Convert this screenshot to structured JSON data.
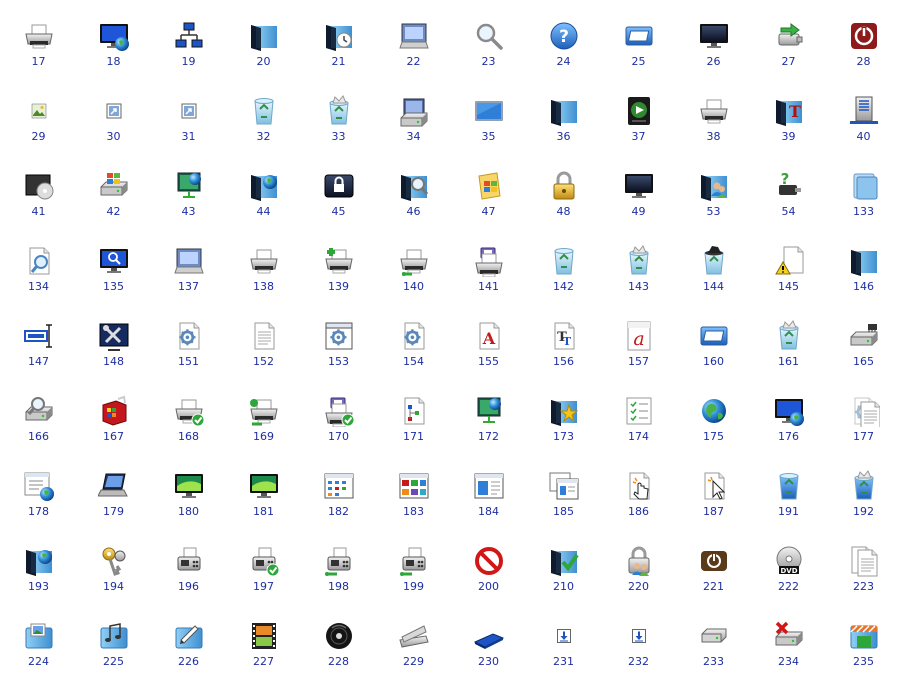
{
  "colors": {
    "label": "#1e2ea3",
    "background": "#ffffff"
  },
  "icons": [
    {
      "label": "17",
      "icon": "printer-icon"
    },
    {
      "label": "18",
      "icon": "network-monitor-globe-icon"
    },
    {
      "label": "19",
      "icon": "network-computers-icon"
    },
    {
      "label": "20",
      "icon": "folder-icon"
    },
    {
      "label": "21",
      "icon": "folder-clock-icon"
    },
    {
      "label": "22",
      "icon": "computer-window-icon"
    },
    {
      "label": "23",
      "icon": "magnifier-icon"
    },
    {
      "label": "24",
      "icon": "help-icon"
    },
    {
      "label": "25",
      "icon": "window-frame-icon"
    },
    {
      "label": "26",
      "icon": "monitor-icon"
    },
    {
      "label": "27",
      "icon": "usb-drive-arrow-icon"
    },
    {
      "label": "28",
      "icon": "power-button-red-icon"
    },
    {
      "label": "29",
      "icon": "small-picture-icon"
    },
    {
      "label": "30",
      "icon": "shortcut-arrow-icon"
    },
    {
      "label": "31",
      "icon": "shortcut-arrow-icon"
    },
    {
      "label": "32",
      "icon": "recycle-bin-empty-icon"
    },
    {
      "label": "33",
      "icon": "recycle-bin-full-icon"
    },
    {
      "label": "34",
      "icon": "computer-drive-icon"
    },
    {
      "label": "35",
      "icon": "screen-blue-icon"
    },
    {
      "label": "36",
      "icon": "folder-icon"
    },
    {
      "label": "37",
      "icon": "media-player-icon"
    },
    {
      "label": "38",
      "icon": "printer-icon"
    },
    {
      "label": "39",
      "icon": "folder-fonts-icon"
    },
    {
      "label": "40",
      "icon": "server-network-icon"
    },
    {
      "label": "41",
      "icon": "disc-drive-icon"
    },
    {
      "label": "42",
      "icon": "windows-drive-icon"
    },
    {
      "label": "43",
      "icon": "network-screen-icon"
    },
    {
      "label": "44",
      "icon": "folder-globe-icon"
    },
    {
      "label": "45",
      "icon": "lock-screen-icon"
    },
    {
      "label": "46",
      "icon": "folder-search-icon"
    },
    {
      "label": "47",
      "icon": "windows-document-icon"
    },
    {
      "label": "48",
      "icon": "padlock-icon"
    },
    {
      "label": "49",
      "icon": "monitor-icon"
    },
    {
      "label": "53",
      "icon": "folder-users-icon"
    },
    {
      "label": "54",
      "icon": "usb-question-icon"
    },
    {
      "label": "133",
      "icon": "folder-stack-icon"
    },
    {
      "label": "134",
      "icon": "document-search-icon"
    },
    {
      "label": "135",
      "icon": "monitor-search-icon"
    },
    {
      "label": "137",
      "icon": "computer-window-icon"
    },
    {
      "label": "138",
      "icon": "printer-icon"
    },
    {
      "label": "139",
      "icon": "printer-add-icon"
    },
    {
      "label": "140",
      "icon": "printer-network-icon"
    },
    {
      "label": "141",
      "icon": "printer-fax-icon"
    },
    {
      "label": "142",
      "icon": "recycle-bin-empty-icon"
    },
    {
      "label": "143",
      "icon": "recycle-bin-full-icon"
    },
    {
      "label": "144",
      "icon": "recycle-bin-dark-icon"
    },
    {
      "label": "145",
      "icon": "document-warning-icon"
    },
    {
      "label": "146",
      "icon": "folder-icon"
    },
    {
      "label": "147",
      "icon": "text-cursor-icon"
    },
    {
      "label": "148",
      "icon": "tools-screen-icon"
    },
    {
      "label": "151",
      "icon": "document-gear-icon"
    },
    {
      "label": "152",
      "icon": "document-text-icon"
    },
    {
      "label": "153",
      "icon": "settings-gear-box-icon"
    },
    {
      "label": "154",
      "icon": "document-gear-icon"
    },
    {
      "label": "155",
      "icon": "font-a-icon"
    },
    {
      "label": "156",
      "icon": "font-truetype-icon"
    },
    {
      "label": "157",
      "icon": "font-a-italic-icon"
    },
    {
      "label": "160",
      "icon": "window-frame-icon"
    },
    {
      "label": "161",
      "icon": "recycle-bin-full-icon"
    },
    {
      "label": "165",
      "icon": "drive-chip-icon"
    },
    {
      "label": "166",
      "icon": "drive-search-icon"
    },
    {
      "label": "167",
      "icon": "software-box-icon"
    },
    {
      "label": "168",
      "icon": "printer-check-icon"
    },
    {
      "label": "169",
      "icon": "printer-network-check-icon"
    },
    {
      "label": "170",
      "icon": "printer-fax-check-icon"
    },
    {
      "label": "171",
      "icon": "document-tree-icon"
    },
    {
      "label": "172",
      "icon": "network-screen-icon"
    },
    {
      "label": "173",
      "icon": "folder-star-icon"
    },
    {
      "label": "174",
      "icon": "checklist-icon"
    },
    {
      "label": "175",
      "icon": "globe-icon"
    },
    {
      "label": "176",
      "icon": "monitor-globe-icon"
    },
    {
      "label": "177",
      "icon": "document-gear-faded-icon"
    },
    {
      "label": "178",
      "icon": "list-globe-icon"
    },
    {
      "label": "179",
      "icon": "laptop-icon"
    },
    {
      "label": "180",
      "icon": "monitor-green-icon"
    },
    {
      "label": "181",
      "icon": "monitor-green-icon"
    },
    {
      "label": "182",
      "icon": "window-grid-icon"
    },
    {
      "label": "183",
      "icon": "window-tiles-icon"
    },
    {
      "label": "184",
      "icon": "window-preview-icon"
    },
    {
      "label": "185",
      "icon": "windows-stacked-icon"
    },
    {
      "label": "186",
      "icon": "document-hand-cursor-icon"
    },
    {
      "label": "187",
      "icon": "document-pointer-icon"
    },
    {
      "label": "191",
      "icon": "recycle-bin-blue-icon"
    },
    {
      "label": "192",
      "icon": "recycle-bin-blue-full-icon"
    },
    {
      "label": "193",
      "icon": "folder-globe-icon"
    },
    {
      "label": "194",
      "icon": "keys-icon"
    },
    {
      "label": "196",
      "icon": "fax-machine-icon"
    },
    {
      "label": "197",
      "icon": "fax-machine-check-icon"
    },
    {
      "label": "198",
      "icon": "fax-machine-network-icon"
    },
    {
      "label": "199",
      "icon": "fax-machine-network-icon"
    },
    {
      "label": "200",
      "icon": "prohibited-icon"
    },
    {
      "label": "210",
      "icon": "folder-check-icon"
    },
    {
      "label": "220",
      "icon": "padlock-users-icon"
    },
    {
      "label": "221",
      "icon": "power-button-brown-icon"
    },
    {
      "label": "222",
      "icon": "dvd-disc-icon"
    },
    {
      "label": "223",
      "icon": "documents-stack-icon"
    },
    {
      "label": "224",
      "icon": "folder-pictures-icon"
    },
    {
      "label": "225",
      "icon": "folder-music-icon"
    },
    {
      "label": "226",
      "icon": "folder-edit-icon"
    },
    {
      "label": "227",
      "icon": "film-strip-icon"
    },
    {
      "label": "228",
      "icon": "media-disc-black-icon"
    },
    {
      "label": "229",
      "icon": "scanner-icon"
    },
    {
      "label": "230",
      "icon": "floppy-blue-icon"
    },
    {
      "label": "231",
      "icon": "download-arrow-icon"
    },
    {
      "label": "232",
      "icon": "download-arrow-icon"
    },
    {
      "label": "233",
      "icon": "removable-drive-icon"
    },
    {
      "label": "234",
      "icon": "drive-delete-icon"
    },
    {
      "label": "235",
      "icon": "folder-store-icon"
    }
  ]
}
